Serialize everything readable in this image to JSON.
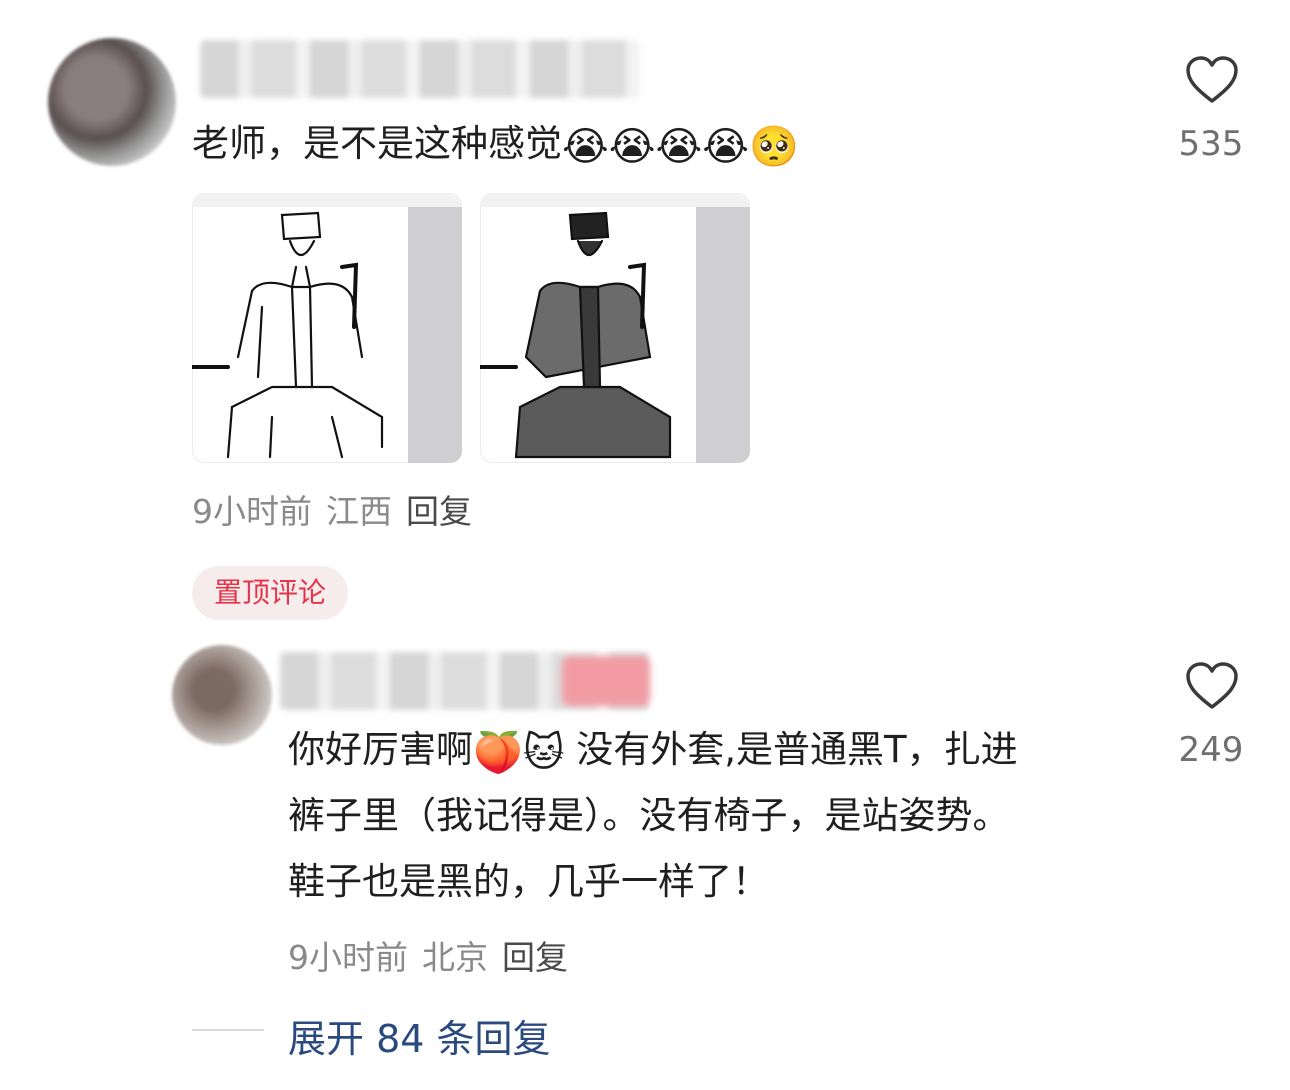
{
  "comment": {
    "text": "老师，是不是这种感觉",
    "emojis": [
      "😭",
      "😭",
      "😭",
      "😭",
      "🥺"
    ],
    "time": "9小时前",
    "location": "江西",
    "reply_label": "回复",
    "likes": "535"
  },
  "pinned_badge": "置顶评论",
  "reply": {
    "line1_prefix": "你好厉害啊",
    "line1_emojis": [
      "🍑",
      "🐱"
    ],
    "line1_suffix": "没有外套,是普通黑T，扎进",
    "line2": "裤子里（我记得是）。没有椅子，是站姿势。",
    "line3": "鞋子也是黑的，几乎一样了！",
    "time": "9小时前",
    "location": "北京",
    "reply_label": "回复",
    "likes": "249"
  },
  "expand_replies": "展开 84 条回复",
  "colors": {
    "accent_red": "#e5334a",
    "link_blue": "#2a4a7f",
    "meta_gray": "#8a8a8a"
  }
}
